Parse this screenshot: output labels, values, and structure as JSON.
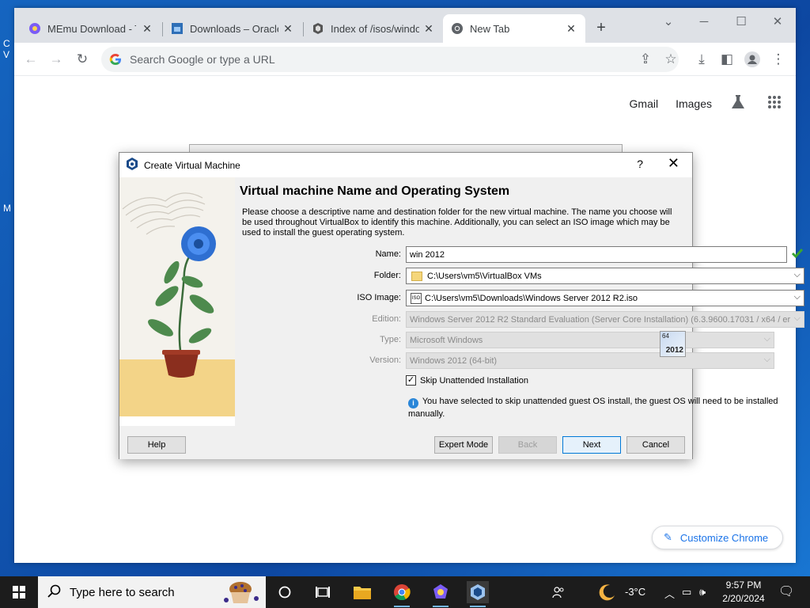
{
  "desktop": {
    "fragments": [
      "C",
      "V",
      "M"
    ]
  },
  "browser": {
    "tabs": [
      {
        "title": "MEmu Download - Th",
        "icon": "memu-icon",
        "active": false
      },
      {
        "title": "Downloads – Oracle V",
        "icon": "oracle-icon",
        "active": false
      },
      {
        "title": "Index of /isos/windo",
        "icon": "archive-icon",
        "active": false
      },
      {
        "title": "New Tab",
        "icon": "chrome-icon",
        "active": true
      }
    ],
    "new_tab_symbol": "+",
    "address_placeholder": "Search Google or type a URL",
    "ntp_links": {
      "gmail": "Gmail",
      "images": "Images"
    },
    "customize_label": "Customize Chrome"
  },
  "dialog": {
    "title": "Create Virtual Machine",
    "help_symbol": "?",
    "heading": "Virtual machine Name and Operating System",
    "description": "Please choose a descriptive name and destination folder for the new virtual machine. The name you choose will be used throughout VirtualBox to identify this machine. Additionally, you can select an ISO image which may be used to install the guest operating system.",
    "fields": {
      "name_label": "Name:",
      "name_value": "win 2012",
      "folder_label": "Folder:",
      "folder_value": "C:\\Users\\vm5\\VirtualBox VMs",
      "iso_label": "ISO Image:",
      "iso_value": "C:\\Users\\vm5\\Downloads\\Windows Server 2012 R2.iso",
      "edition_label": "Edition:",
      "edition_value": "Windows Server 2012 R2 Standard Evaluation (Server Core Installation) (6.3.9600.17031 / x64 / er",
      "type_label": "Type:",
      "type_value": "Microsoft Windows",
      "version_label": "Version:",
      "version_value": "Windows 2012 (64-bit)"
    },
    "os_badge": {
      "bits": "64",
      "year": "2012"
    },
    "skip_unattended": {
      "label": "Skip Unattended Installation",
      "checked": true
    },
    "info_text": "You have selected to skip unattended guest OS install, the guest OS will need to be installed manually.",
    "buttons": {
      "help": "Help",
      "expert": "Expert Mode",
      "back": "Back",
      "next": "Next",
      "cancel": "Cancel"
    }
  },
  "taskbar": {
    "search_placeholder": "Type here to search",
    "weather": "-3°C",
    "time": "9:57 PM",
    "date": "2/20/2024"
  }
}
